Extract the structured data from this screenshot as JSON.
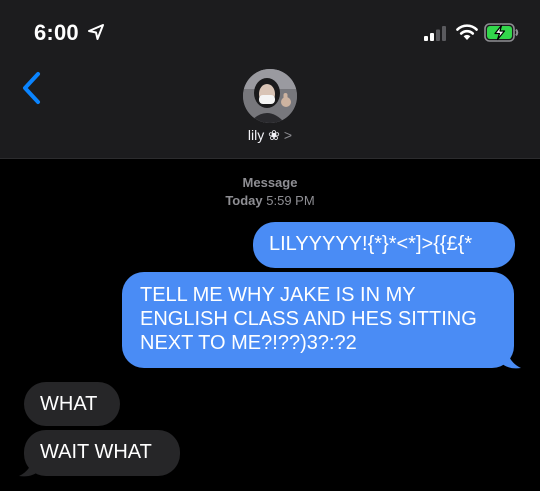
{
  "status_bar": {
    "time": "6:00",
    "icons": [
      "location-arrow-icon",
      "cellular-signal-icon",
      "wifi-icon",
      "battery-charging-icon"
    ]
  },
  "header": {
    "back_icon": "chevron-left-icon",
    "contact_name": "lily ❀",
    "contact_chevron": ">"
  },
  "thread": {
    "service_label": "Message",
    "timestamp_day": "Today",
    "timestamp_time": "5:59 PM",
    "messages": [
      {
        "direction": "sent",
        "text": "LILYYYYY!{*}*<*]>{{£{*"
      },
      {
        "direction": "sent",
        "text": "TELL ME WHY JAKE IS IN MY ENGLISH CLASS AND HES SITTING NEXT TO ME?!??)3?:?2"
      },
      {
        "direction": "received",
        "text": "WHAT"
      },
      {
        "direction": "received",
        "text": "WAIT WHAT"
      }
    ]
  },
  "colors": {
    "header_bg": "#1c1c1e",
    "sent_bubble": "#4a8cf5",
    "received_bubble": "#262628",
    "accent_blue": "#0a84ff",
    "secondary_text": "#8e8e93"
  }
}
